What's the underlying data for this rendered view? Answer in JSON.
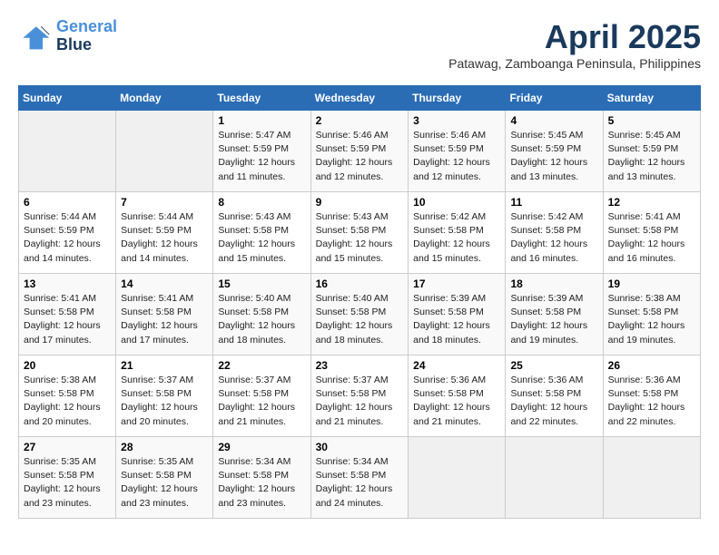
{
  "logo": {
    "line1": "General",
    "line2": "Blue"
  },
  "title": "April 2025",
  "subtitle": "Patawag, Zamboanga Peninsula, Philippines",
  "headers": [
    "Sunday",
    "Monday",
    "Tuesday",
    "Wednesday",
    "Thursday",
    "Friday",
    "Saturday"
  ],
  "weeks": [
    [
      {
        "day": "",
        "info": ""
      },
      {
        "day": "",
        "info": ""
      },
      {
        "day": "1",
        "info": "Sunrise: 5:47 AM\nSunset: 5:59 PM\nDaylight: 12 hours\nand 11 minutes."
      },
      {
        "day": "2",
        "info": "Sunrise: 5:46 AM\nSunset: 5:59 PM\nDaylight: 12 hours\nand 12 minutes."
      },
      {
        "day": "3",
        "info": "Sunrise: 5:46 AM\nSunset: 5:59 PM\nDaylight: 12 hours\nand 12 minutes."
      },
      {
        "day": "4",
        "info": "Sunrise: 5:45 AM\nSunset: 5:59 PM\nDaylight: 12 hours\nand 13 minutes."
      },
      {
        "day": "5",
        "info": "Sunrise: 5:45 AM\nSunset: 5:59 PM\nDaylight: 12 hours\nand 13 minutes."
      }
    ],
    [
      {
        "day": "6",
        "info": "Sunrise: 5:44 AM\nSunset: 5:59 PM\nDaylight: 12 hours\nand 14 minutes."
      },
      {
        "day": "7",
        "info": "Sunrise: 5:44 AM\nSunset: 5:59 PM\nDaylight: 12 hours\nand 14 minutes."
      },
      {
        "day": "8",
        "info": "Sunrise: 5:43 AM\nSunset: 5:58 PM\nDaylight: 12 hours\nand 15 minutes."
      },
      {
        "day": "9",
        "info": "Sunrise: 5:43 AM\nSunset: 5:58 PM\nDaylight: 12 hours\nand 15 minutes."
      },
      {
        "day": "10",
        "info": "Sunrise: 5:42 AM\nSunset: 5:58 PM\nDaylight: 12 hours\nand 15 minutes."
      },
      {
        "day": "11",
        "info": "Sunrise: 5:42 AM\nSunset: 5:58 PM\nDaylight: 12 hours\nand 16 minutes."
      },
      {
        "day": "12",
        "info": "Sunrise: 5:41 AM\nSunset: 5:58 PM\nDaylight: 12 hours\nand 16 minutes."
      }
    ],
    [
      {
        "day": "13",
        "info": "Sunrise: 5:41 AM\nSunset: 5:58 PM\nDaylight: 12 hours\nand 17 minutes."
      },
      {
        "day": "14",
        "info": "Sunrise: 5:41 AM\nSunset: 5:58 PM\nDaylight: 12 hours\nand 17 minutes."
      },
      {
        "day": "15",
        "info": "Sunrise: 5:40 AM\nSunset: 5:58 PM\nDaylight: 12 hours\nand 18 minutes."
      },
      {
        "day": "16",
        "info": "Sunrise: 5:40 AM\nSunset: 5:58 PM\nDaylight: 12 hours\nand 18 minutes."
      },
      {
        "day": "17",
        "info": "Sunrise: 5:39 AM\nSunset: 5:58 PM\nDaylight: 12 hours\nand 18 minutes."
      },
      {
        "day": "18",
        "info": "Sunrise: 5:39 AM\nSunset: 5:58 PM\nDaylight: 12 hours\nand 19 minutes."
      },
      {
        "day": "19",
        "info": "Sunrise: 5:38 AM\nSunset: 5:58 PM\nDaylight: 12 hours\nand 19 minutes."
      }
    ],
    [
      {
        "day": "20",
        "info": "Sunrise: 5:38 AM\nSunset: 5:58 PM\nDaylight: 12 hours\nand 20 minutes."
      },
      {
        "day": "21",
        "info": "Sunrise: 5:37 AM\nSunset: 5:58 PM\nDaylight: 12 hours\nand 20 minutes."
      },
      {
        "day": "22",
        "info": "Sunrise: 5:37 AM\nSunset: 5:58 PM\nDaylight: 12 hours\nand 21 minutes."
      },
      {
        "day": "23",
        "info": "Sunrise: 5:37 AM\nSunset: 5:58 PM\nDaylight: 12 hours\nand 21 minutes."
      },
      {
        "day": "24",
        "info": "Sunrise: 5:36 AM\nSunset: 5:58 PM\nDaylight: 12 hours\nand 21 minutes."
      },
      {
        "day": "25",
        "info": "Sunrise: 5:36 AM\nSunset: 5:58 PM\nDaylight: 12 hours\nand 22 minutes."
      },
      {
        "day": "26",
        "info": "Sunrise: 5:36 AM\nSunset: 5:58 PM\nDaylight: 12 hours\nand 22 minutes."
      }
    ],
    [
      {
        "day": "27",
        "info": "Sunrise: 5:35 AM\nSunset: 5:58 PM\nDaylight: 12 hours\nand 23 minutes."
      },
      {
        "day": "28",
        "info": "Sunrise: 5:35 AM\nSunset: 5:58 PM\nDaylight: 12 hours\nand 23 minutes."
      },
      {
        "day": "29",
        "info": "Sunrise: 5:34 AM\nSunset: 5:58 PM\nDaylight: 12 hours\nand 23 minutes."
      },
      {
        "day": "30",
        "info": "Sunrise: 5:34 AM\nSunset: 5:58 PM\nDaylight: 12 hours\nand 24 minutes."
      },
      {
        "day": "",
        "info": ""
      },
      {
        "day": "",
        "info": ""
      },
      {
        "day": "",
        "info": ""
      }
    ]
  ]
}
